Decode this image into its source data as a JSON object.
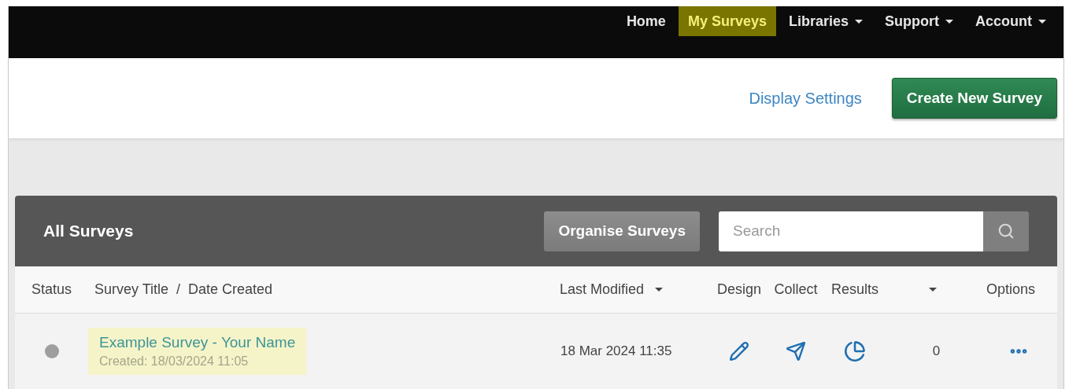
{
  "nav": {
    "items": [
      {
        "label": "Home",
        "selected": false,
        "dropdown": false
      },
      {
        "label": "My Surveys",
        "selected": true,
        "dropdown": false
      },
      {
        "label": "Libraries",
        "selected": false,
        "dropdown": true
      },
      {
        "label": "Support",
        "selected": false,
        "dropdown": true
      },
      {
        "label": "Account",
        "selected": false,
        "dropdown": true
      }
    ]
  },
  "toolbar": {
    "link": "Display Settings",
    "button": "Create New Survey"
  },
  "panel": {
    "title": "All Surveys",
    "organise_button": "Organise Surveys",
    "search": {
      "placeholder": "Search"
    },
    "columns": [
      {
        "label": "Status",
        "sort": false
      },
      {
        "label": "Survey Title  /  Date Created",
        "sort": false
      },
      {
        "label": "Last Modified",
        "sort": true
      },
      {
        "label": "Design",
        "sort": false
      },
      {
        "label": "Collect",
        "sort": false
      },
      {
        "label": "Results",
        "sort": false
      },
      {
        "sort": true
      },
      {
        "label": "Options",
        "sort": false
      }
    ],
    "rows": [
      {
        "color": "#9e9e9e",
        "title": "Example Survey - Your Name",
        "created": "Created: 18/03/2024 11:05",
        "highlighted": true,
        "last_modified": "18 Mar 2024 11:35",
        "responses": "0"
      }
    ]
  }
}
